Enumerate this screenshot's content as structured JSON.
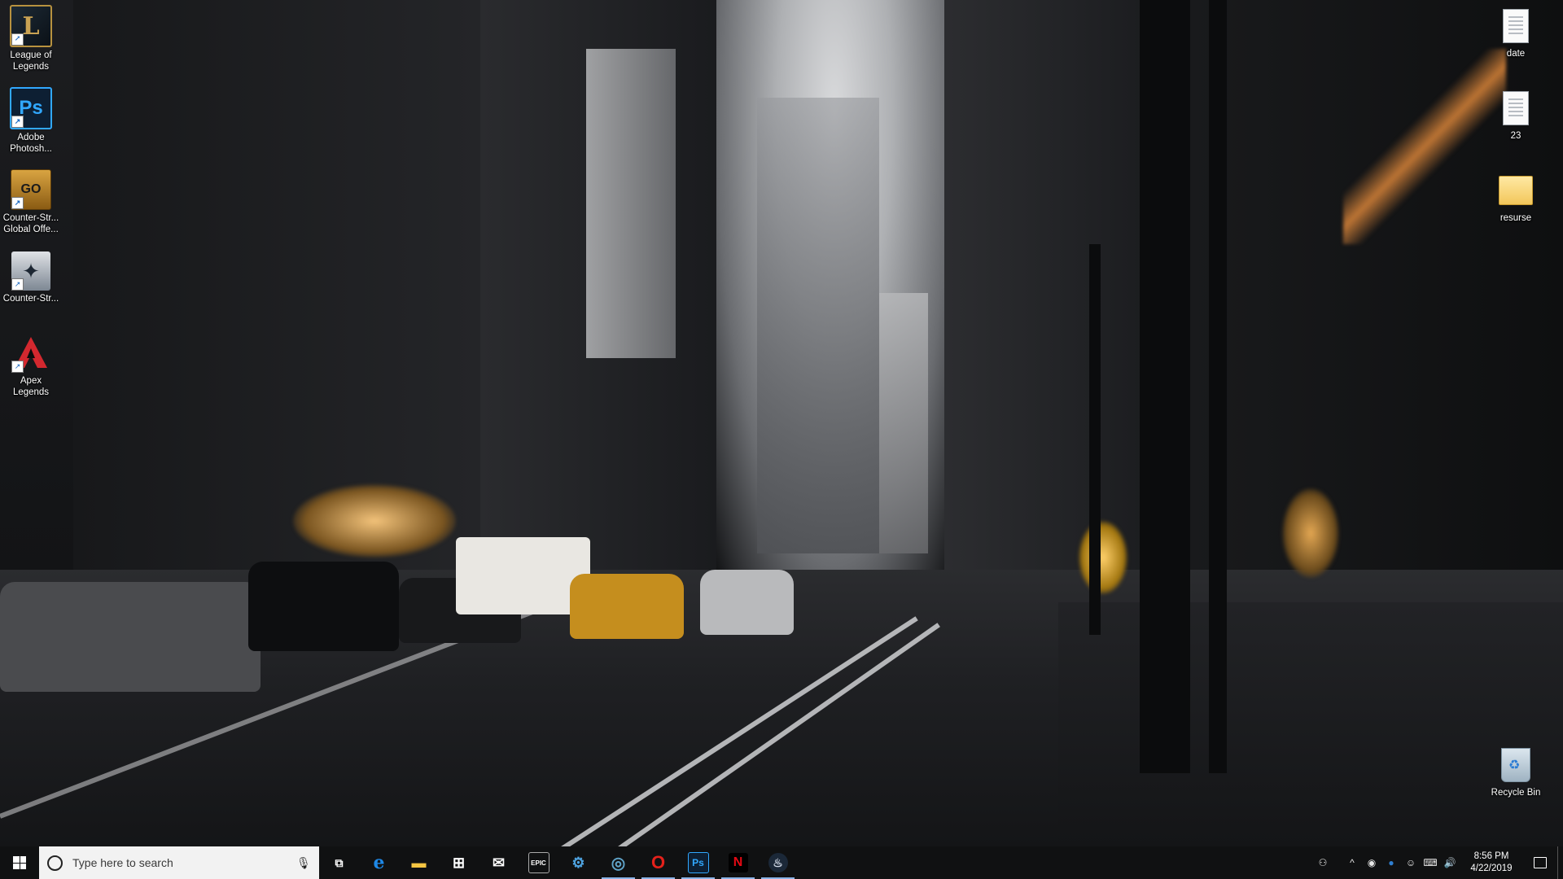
{
  "desktop": {
    "icons_left": [
      {
        "label": "League of\nLegends",
        "glyph": "L",
        "icon": "league-of-legends-icon"
      },
      {
        "label": "Adobe\nPhotosh...",
        "glyph": "Ps",
        "icon": "photoshop-icon"
      },
      {
        "label": "Counter-Str...\nGlobal Offe...",
        "glyph": "GO",
        "icon": "csgo-icon"
      },
      {
        "label": "Counter-Str...",
        "glyph": "✦",
        "icon": "counter-strike-icon"
      },
      {
        "label": "Apex\nLegends",
        "glyph": "A",
        "icon": "apex-legends-icon"
      }
    ],
    "icons_right": [
      {
        "label": "date",
        "icon": "text-file-icon"
      },
      {
        "label": "23",
        "icon": "text-file-icon"
      },
      {
        "label": "resurse",
        "icon": "folder-icon"
      },
      {
        "label": "Recycle Bin",
        "icon": "recycle-bin-icon"
      }
    ]
  },
  "taskbar": {
    "search_placeholder": "Type here to search",
    "pinned": [
      {
        "icon": "task-view-icon",
        "glyph": "⧉",
        "color": "#ffffff"
      },
      {
        "icon": "edge-icon",
        "glyph": "e",
        "color": "#1e88e5"
      },
      {
        "icon": "file-explorer-icon",
        "glyph": "▬",
        "color": "#f4c542"
      },
      {
        "icon": "store-icon",
        "glyph": "⊞",
        "color": "#ffffff"
      },
      {
        "icon": "mail-icon",
        "glyph": "✉",
        "color": "#ffffff"
      },
      {
        "icon": "epic-games-icon",
        "glyph": "EPIC",
        "color": "#ffffff"
      },
      {
        "icon": "network-app-icon",
        "glyph": "⚙",
        "color": "#4ea3e0"
      },
      {
        "icon": "origin-icon",
        "glyph": "◎",
        "color": "#5fa3c8"
      },
      {
        "icon": "opera-icon",
        "glyph": "O",
        "color": "#e5211b"
      },
      {
        "icon": "photoshop-icon",
        "glyph": "Ps",
        "color": "#31a8ff"
      },
      {
        "icon": "netflix-icon",
        "glyph": "N",
        "color": "#e50914"
      },
      {
        "icon": "steam-icon",
        "glyph": "♨",
        "color": "#cfd8e6"
      }
    ],
    "tray": [
      {
        "icon": "people-icon",
        "glyph": "⚇"
      },
      {
        "icon": "show-hidden-icons-chevron-icon",
        "glyph": "^"
      },
      {
        "icon": "target-app-icon",
        "glyph": "◉"
      },
      {
        "icon": "globe-app-icon",
        "glyph": "●"
      },
      {
        "icon": "discord-icon",
        "glyph": "☺"
      },
      {
        "icon": "network-icon",
        "glyph": "⌨"
      },
      {
        "icon": "volume-icon",
        "glyph": "🔊"
      }
    ],
    "time": "8:56 PM",
    "date": "4/22/2019"
  }
}
